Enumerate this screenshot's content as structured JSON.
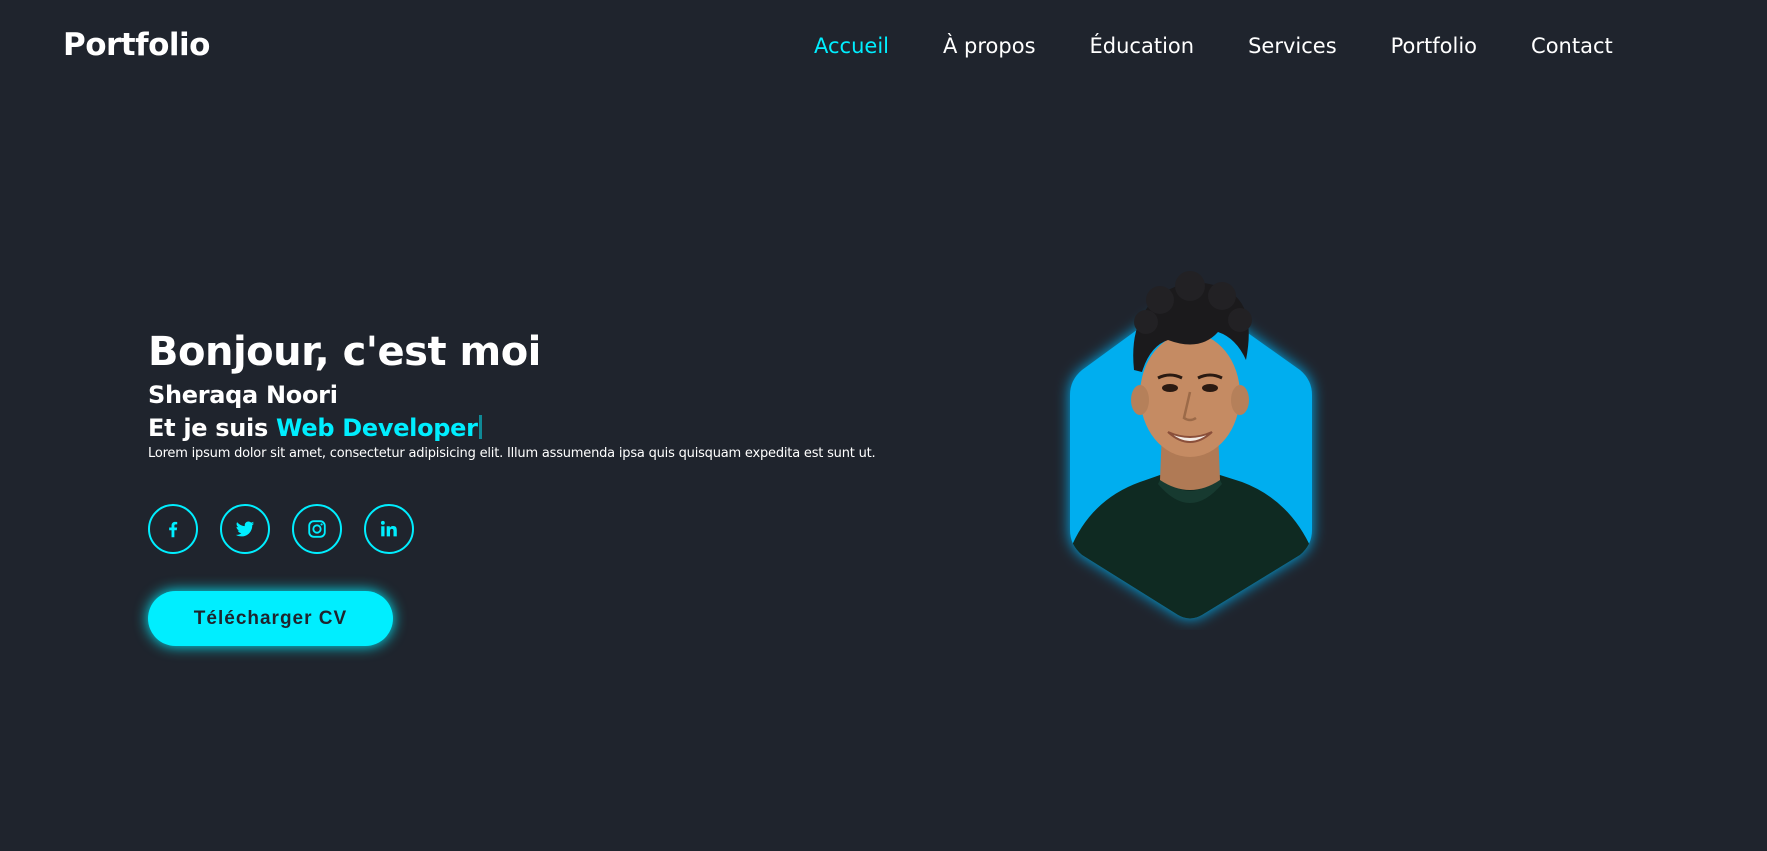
{
  "header": {
    "logo": "Portfolio",
    "nav": [
      {
        "label": "Accueil",
        "active": true
      },
      {
        "label": "À propos",
        "active": false
      },
      {
        "label": "Éducation",
        "active": false
      },
      {
        "label": "Services",
        "active": false
      },
      {
        "label": "Portfolio",
        "active": false
      },
      {
        "label": "Contact",
        "active": false
      }
    ]
  },
  "hero": {
    "greeting": "Bonjour, c'est moi",
    "name": "Sheraqa Noori",
    "role_prefix": "Et je suis ",
    "role_highlight": "Web Developer",
    "description": "Lorem ipsum dolor sit amet, consectetur adipisicing elit. Illum assumenda ipsa quis quisquam expedita est sunt ut.",
    "cta_label": "Télécharger CV",
    "socials": [
      {
        "icon": "facebook-icon"
      },
      {
        "icon": "twitter-icon"
      },
      {
        "icon": "instagram-icon"
      },
      {
        "icon": "linkedin-icon"
      }
    ]
  },
  "colors": {
    "background": "#1f242d",
    "accent": "#00eeff",
    "hexagon": "#00aeef"
  }
}
